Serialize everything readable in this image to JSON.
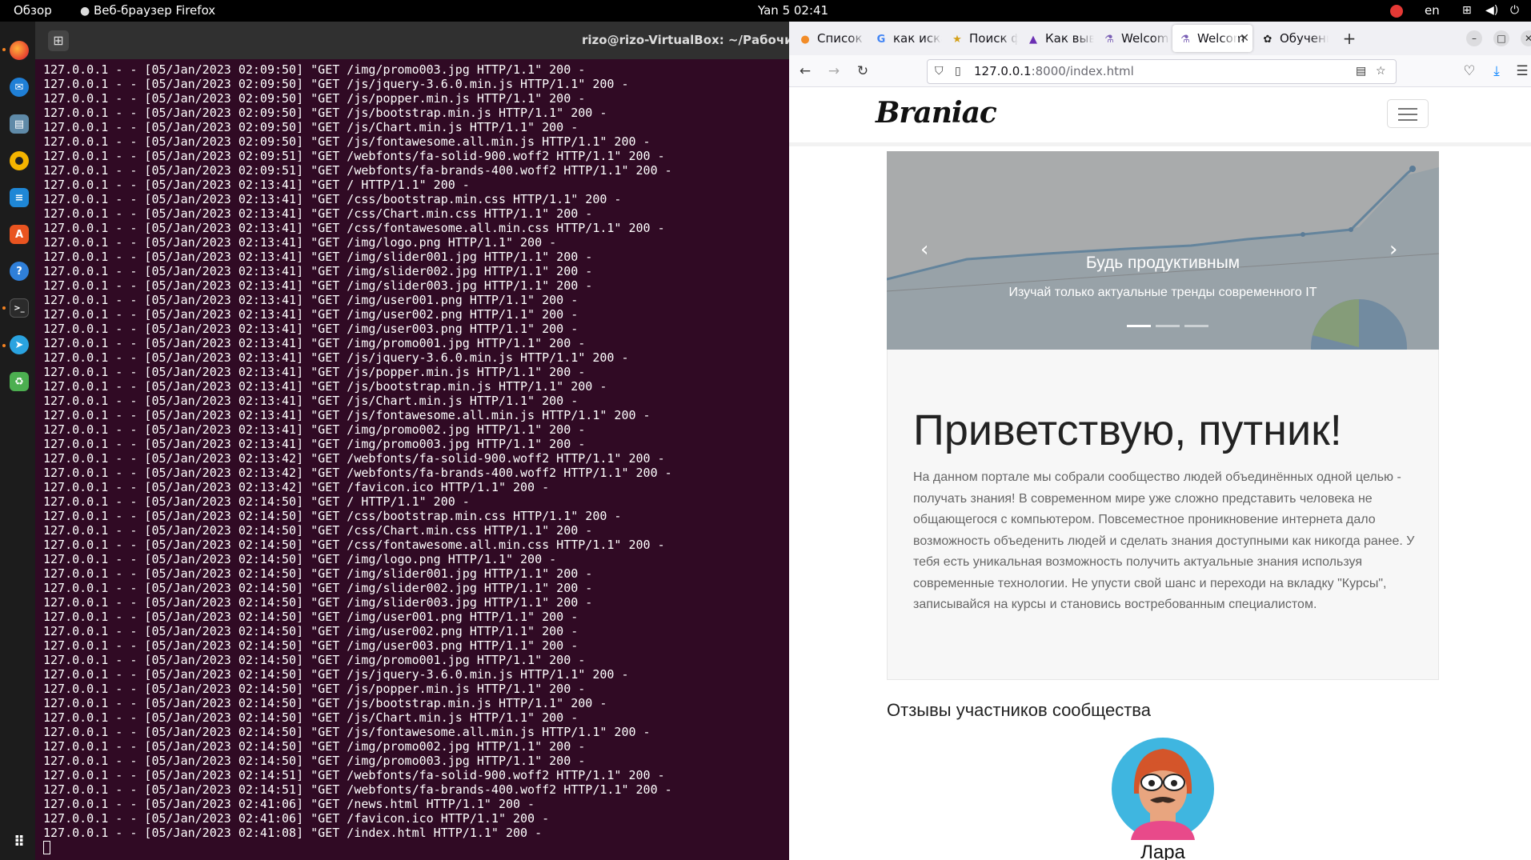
{
  "topbar": {
    "activities": "Обзор",
    "app_name": "Веб-браузер Firefox",
    "clock": "Yan 5  02:41",
    "lang": "en"
  },
  "dock": {
    "items": [
      "firefox-icon",
      "thunderbird-icon",
      "files-icon",
      "rhythmbox-icon",
      "libreoffice-writer-icon",
      "software-center-icon",
      "help-icon",
      "terminal-icon",
      "telegram-icon",
      "trash-icon",
      "app-grid-icon"
    ]
  },
  "terminal": {
    "title": "rizo@rizo-VirtualBox: ~/Рабочий сто",
    "lines": [
      "127.0.0.1 - - [05/Jan/2023 02:09:50] \"GET /img/promo003.jpg HTTP/1.1\" 200 -",
      "127.0.0.1 - - [05/Jan/2023 02:09:50] \"GET /js/jquery-3.6.0.min.js HTTP/1.1\" 200 -",
      "127.0.0.1 - - [05/Jan/2023 02:09:50] \"GET /js/popper.min.js HTTP/1.1\" 200 -",
      "127.0.0.1 - - [05/Jan/2023 02:09:50] \"GET /js/bootstrap.min.js HTTP/1.1\" 200 -",
      "127.0.0.1 - - [05/Jan/2023 02:09:50] \"GET /js/Chart.min.js HTTP/1.1\" 200 -",
      "127.0.0.1 - - [05/Jan/2023 02:09:50] \"GET /js/fontawesome.all.min.js HTTP/1.1\" 200 -",
      "127.0.0.1 - - [05/Jan/2023 02:09:51] \"GET /webfonts/fa-solid-900.woff2 HTTP/1.1\" 200 -",
      "127.0.0.1 - - [05/Jan/2023 02:09:51] \"GET /webfonts/fa-brands-400.woff2 HTTP/1.1\" 200 -",
      "127.0.0.1 - - [05/Jan/2023 02:13:41] \"GET / HTTP/1.1\" 200 -",
      "127.0.0.1 - - [05/Jan/2023 02:13:41] \"GET /css/bootstrap.min.css HTTP/1.1\" 200 -",
      "127.0.0.1 - - [05/Jan/2023 02:13:41] \"GET /css/Chart.min.css HTTP/1.1\" 200 -",
      "127.0.0.1 - - [05/Jan/2023 02:13:41] \"GET /css/fontawesome.all.min.css HTTP/1.1\" 200 -",
      "127.0.0.1 - - [05/Jan/2023 02:13:41] \"GET /img/logo.png HTTP/1.1\" 200 -",
      "127.0.0.1 - - [05/Jan/2023 02:13:41] \"GET /img/slider001.jpg HTTP/1.1\" 200 -",
      "127.0.0.1 - - [05/Jan/2023 02:13:41] \"GET /img/slider002.jpg HTTP/1.1\" 200 -",
      "127.0.0.1 - - [05/Jan/2023 02:13:41] \"GET /img/slider003.jpg HTTP/1.1\" 200 -",
      "127.0.0.1 - - [05/Jan/2023 02:13:41] \"GET /img/user001.png HTTP/1.1\" 200 -",
      "127.0.0.1 - - [05/Jan/2023 02:13:41] \"GET /img/user002.png HTTP/1.1\" 200 -",
      "127.0.0.1 - - [05/Jan/2023 02:13:41] \"GET /img/user003.png HTTP/1.1\" 200 -",
      "127.0.0.1 - - [05/Jan/2023 02:13:41] \"GET /img/promo001.jpg HTTP/1.1\" 200 -",
      "127.0.0.1 - - [05/Jan/2023 02:13:41] \"GET /js/jquery-3.6.0.min.js HTTP/1.1\" 200 -",
      "127.0.0.1 - - [05/Jan/2023 02:13:41] \"GET /js/popper.min.js HTTP/1.1\" 200 -",
      "127.0.0.1 - - [05/Jan/2023 02:13:41] \"GET /js/bootstrap.min.js HTTP/1.1\" 200 -",
      "127.0.0.1 - - [05/Jan/2023 02:13:41] \"GET /js/Chart.min.js HTTP/1.1\" 200 -",
      "127.0.0.1 - - [05/Jan/2023 02:13:41] \"GET /js/fontawesome.all.min.js HTTP/1.1\" 200 -",
      "127.0.0.1 - - [05/Jan/2023 02:13:41] \"GET /img/promo002.jpg HTTP/1.1\" 200 -",
      "127.0.0.1 - - [05/Jan/2023 02:13:41] \"GET /img/promo003.jpg HTTP/1.1\" 200 -",
      "127.0.0.1 - - [05/Jan/2023 02:13:42] \"GET /webfonts/fa-solid-900.woff2 HTTP/1.1\" 200 -",
      "127.0.0.1 - - [05/Jan/2023 02:13:42] \"GET /webfonts/fa-brands-400.woff2 HTTP/1.1\" 200 -",
      "127.0.0.1 - - [05/Jan/2023 02:13:42] \"GET /favicon.ico HTTP/1.1\" 200 -",
      "127.0.0.1 - - [05/Jan/2023 02:14:50] \"GET / HTTP/1.1\" 200 -",
      "127.0.0.1 - - [05/Jan/2023 02:14:50] \"GET /css/bootstrap.min.css HTTP/1.1\" 200 -",
      "127.0.0.1 - - [05/Jan/2023 02:14:50] \"GET /css/Chart.min.css HTTP/1.1\" 200 -",
      "127.0.0.1 - - [05/Jan/2023 02:14:50] \"GET /css/fontawesome.all.min.css HTTP/1.1\" 200 -",
      "127.0.0.1 - - [05/Jan/2023 02:14:50] \"GET /img/logo.png HTTP/1.1\" 200 -",
      "127.0.0.1 - - [05/Jan/2023 02:14:50] \"GET /img/slider001.jpg HTTP/1.1\" 200 -",
      "127.0.0.1 - - [05/Jan/2023 02:14:50] \"GET /img/slider002.jpg HTTP/1.1\" 200 -",
      "127.0.0.1 - - [05/Jan/2023 02:14:50] \"GET /img/slider003.jpg HTTP/1.1\" 200 -",
      "127.0.0.1 - - [05/Jan/2023 02:14:50] \"GET /img/user001.png HTTP/1.1\" 200 -",
      "127.0.0.1 - - [05/Jan/2023 02:14:50] \"GET /img/user002.png HTTP/1.1\" 200 -",
      "127.0.0.1 - - [05/Jan/2023 02:14:50] \"GET /img/user003.png HTTP/1.1\" 200 -",
      "127.0.0.1 - - [05/Jan/2023 02:14:50] \"GET /img/promo001.jpg HTTP/1.1\" 200 -",
      "127.0.0.1 - - [05/Jan/2023 02:14:50] \"GET /js/jquery-3.6.0.min.js HTTP/1.1\" 200 -",
      "127.0.0.1 - - [05/Jan/2023 02:14:50] \"GET /js/popper.min.js HTTP/1.1\" 200 -",
      "127.0.0.1 - - [05/Jan/2023 02:14:50] \"GET /js/bootstrap.min.js HTTP/1.1\" 200 -",
      "127.0.0.1 - - [05/Jan/2023 02:14:50] \"GET /js/Chart.min.js HTTP/1.1\" 200 -",
      "127.0.0.1 - - [05/Jan/2023 02:14:50] \"GET /js/fontawesome.all.min.js HTTP/1.1\" 200 -",
      "127.0.0.1 - - [05/Jan/2023 02:14:50] \"GET /img/promo002.jpg HTTP/1.1\" 200 -",
      "127.0.0.1 - - [05/Jan/2023 02:14:50] \"GET /img/promo003.jpg HTTP/1.1\" 200 -",
      "127.0.0.1 - - [05/Jan/2023 02:14:51] \"GET /webfonts/fa-solid-900.woff2 HTTP/1.1\" 200 -",
      "127.0.0.1 - - [05/Jan/2023 02:14:51] \"GET /webfonts/fa-brands-400.woff2 HTTP/1.1\" 200 -",
      "127.0.0.1 - - [05/Jan/2023 02:41:06] \"GET /news.html HTTP/1.1\" 200 -",
      "127.0.0.1 - - [05/Jan/2023 02:41:06] \"GET /favicon.ico HTTP/1.1\" 200 -",
      "127.0.0.1 - - [05/Jan/2023 02:41:08] \"GET /index.html HTTP/1.1\" 200 -"
    ]
  },
  "browser": {
    "tabs": [
      {
        "label": "Список у",
        "icon": "habr-icon"
      },
      {
        "label": "как искат",
        "icon": "google-icon"
      },
      {
        "label": "Поиск фа",
        "icon": "star-icon"
      },
      {
        "label": "Как выве",
        "icon": "triangle-icon"
      },
      {
        "label": "Welcome",
        "icon": "flask-icon"
      },
      {
        "label": "Welcom",
        "icon": "flask-icon",
        "active": true
      },
      {
        "label": "Обучени",
        "icon": "openai-icon"
      }
    ],
    "url_host": "127.0.0.1",
    "url_rest": ":8000/index.html"
  },
  "site": {
    "brand": "Braniac",
    "carousel": {
      "title": "Будь продуктивным",
      "subtitle": "Изучай только актуальные тренды современного IT",
      "slide_count": 3,
      "active_index": 0
    },
    "jumbotron": {
      "title": "Приветствую, путник!",
      "text": "На данном портале мы собрали сообщество людей объединённых одной целью - получать знания! В современном мире уже сложно представить человека не общающегося с компьютером. Повсеместное проникновение интернета дало возможность объеденить людей и сделать знания доступными как никогда ранее. У тебя есть уникальная возможность получить актуальные знания используя современные технологии. Не упусти свой шанс и переходи на вкладку \"Курсы\", записывайся на курсы и становись востребованным специалистом."
    },
    "reviews": {
      "title": "Отзывы участников сообщества",
      "first_name": "Лара"
    }
  },
  "colors": {
    "terminal_bg": "#300a24",
    "ubuntu_orange": "#f58220"
  }
}
